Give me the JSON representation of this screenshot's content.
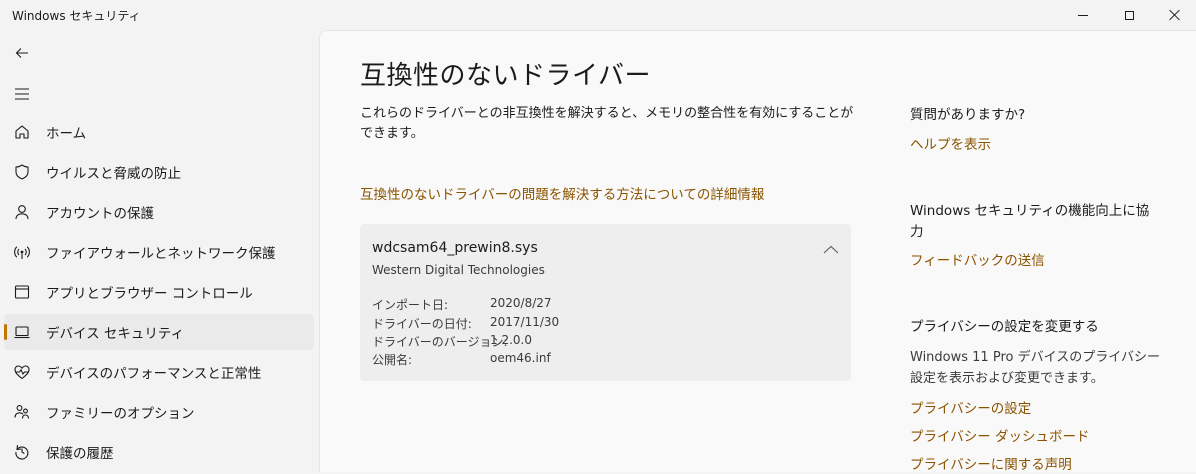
{
  "window": {
    "title": "Windows セキュリティ"
  },
  "sidebar": {
    "items": [
      {
        "label": "ホーム",
        "icon": "home-icon"
      },
      {
        "label": "ウイルスと脅威の防止",
        "icon": "shield-icon"
      },
      {
        "label": "アカウントの保護",
        "icon": "person-icon"
      },
      {
        "label": "ファイアウォールとネットワーク保護",
        "icon": "wireless-icon"
      },
      {
        "label": "アプリとブラウザー コントロール",
        "icon": "browser-window-icon"
      },
      {
        "label": "デバイス セキュリティ",
        "icon": "laptop-icon",
        "selected": true
      },
      {
        "label": "デバイスのパフォーマンスと正常性",
        "icon": "heart-pulse-icon"
      },
      {
        "label": "ファミリーのオプション",
        "icon": "family-icon"
      },
      {
        "label": "保護の履歴",
        "icon": "history-icon"
      }
    ]
  },
  "main": {
    "title": "互換性のないドライバー",
    "description": "これらのドライバーとの非互換性を解決すると、メモリの整合性を有効にすることができます。",
    "learn_more_link": "互換性のないドライバーの問題を解決する方法についての詳細情報",
    "driver": {
      "name": "wdcsam64_prewin8.sys",
      "vendor": "Western Digital Technologies",
      "details": [
        {
          "label": "インポート日:",
          "value": "2020/8/27"
        },
        {
          "label": "ドライバーの日付:",
          "value": "2017/11/30"
        },
        {
          "label": "ドライバーのバージョン:",
          "value": "1.2.0.0"
        },
        {
          "label": "公開名:",
          "value": "oem46.inf"
        }
      ]
    }
  },
  "side": {
    "question_heading": "質問がありますか?",
    "help_link": "ヘルプを表示",
    "improve_heading": "Windows セキュリティの機能向上に協力",
    "feedback_link": "フィードバックの送信",
    "privacy_heading": "プライバシーの設定を変更する",
    "privacy_text": "Windows 11 Pro デバイスのプライバシー設定を表示および変更できます。",
    "privacy_links": [
      "プライバシーの設定",
      "プライバシー ダッシュボード",
      "プライバシーに関する声明"
    ]
  },
  "colors": {
    "accent": "#c27300",
    "link": "#8a5300",
    "card_background": "#eeeeee"
  }
}
